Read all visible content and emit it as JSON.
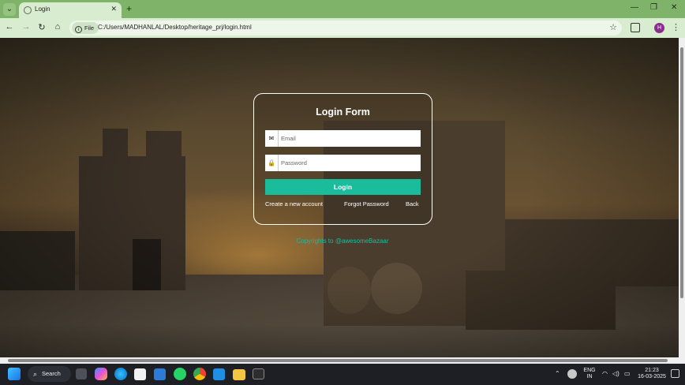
{
  "browser": {
    "tab_title": "Login",
    "tab_close": "✕",
    "new_tab": "+",
    "menu_glyph": "⌄",
    "window_minimize": "—",
    "window_restore": "❐",
    "window_close": "✕",
    "chip_label": "File",
    "chip_icon": "i",
    "url": "C:/Users/MADHANLAL/Desktop/heritage_prj/login.html",
    "profile_initial": "H",
    "nav": {
      "back": "←",
      "forward": "→",
      "reload": "↻",
      "home": "⌂",
      "star": "☆",
      "menu": "⋮"
    }
  },
  "login": {
    "title": "Login Form",
    "email_placeholder": "Email",
    "email_icon": "✉",
    "password_placeholder": "Password",
    "password_icon": "🔒",
    "submit_label": "Login",
    "create_account": "Create a new account",
    "forgot_password": "Forgot Password",
    "back": "Back"
  },
  "footer": {
    "copyright": "Copyrights to @awesomeBazaar"
  },
  "taskbar": {
    "search_label": "Search",
    "search_icon": "⌕",
    "language_top": "ENG",
    "language_bottom": "IN",
    "time": "21:23",
    "date": "16-03-2025",
    "tray_up": "⌃",
    "wifi": "◠",
    "volume": "◁)",
    "battery": "▭"
  },
  "colors": {
    "accent": "#1abc9c",
    "tab_strip": "#7fb36a",
    "toolbar": "#d8ecd0"
  },
  "icons": [
    "windows-start-icon",
    "task-view-icon",
    "copilot-icon",
    "edge-icon",
    "store-icon",
    "calculator-icon",
    "whatsapp-icon",
    "chrome-icon",
    "vscode-icon",
    "file-explorer-icon",
    "terminal-icon"
  ]
}
